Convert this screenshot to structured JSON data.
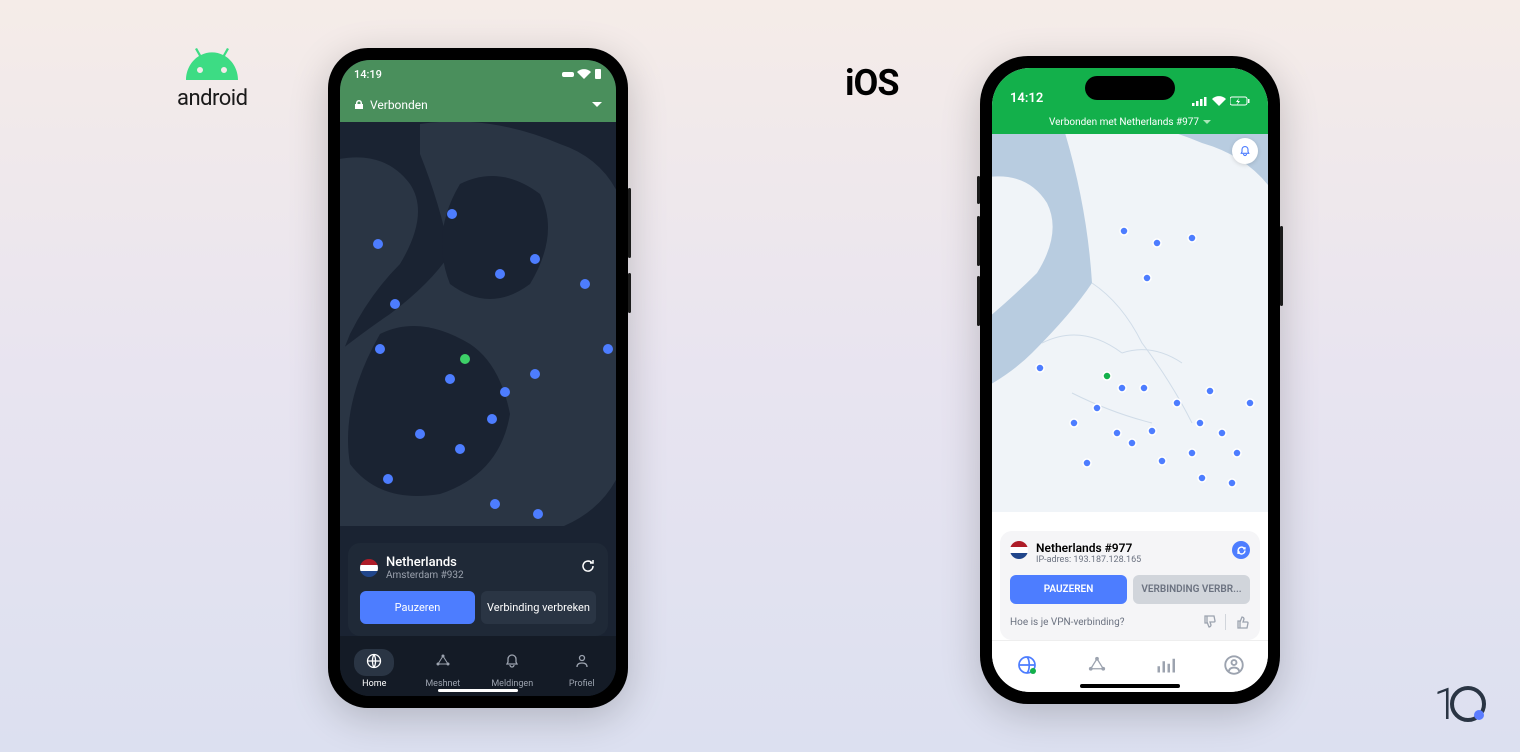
{
  "labels": {
    "android": "android",
    "ios": "iOS"
  },
  "android": {
    "status": {
      "time": "14:19"
    },
    "header": {
      "status": "Verbonden"
    },
    "card": {
      "country": "Netherlands",
      "server": "Amsterdam #932",
      "pause": "Pauzeren",
      "disconnect": "Verbinding verbreken"
    },
    "nav": {
      "home": "Home",
      "meshnet": "Meshnet",
      "meldingen": "Meldingen",
      "profiel": "Profiel"
    }
  },
  "ios": {
    "status": {
      "time": "14:12"
    },
    "header": {
      "status": "Verbonden met Netherlands #977"
    },
    "card": {
      "country": "Netherlands #977",
      "ip": "IP-adres: 193.187.128.165",
      "pause": "PAUZEREN",
      "disconnect": "VERBINDING VERBR...",
      "feedback": "Hoe is je VPN-verbinding?"
    }
  },
  "watermark": "1"
}
